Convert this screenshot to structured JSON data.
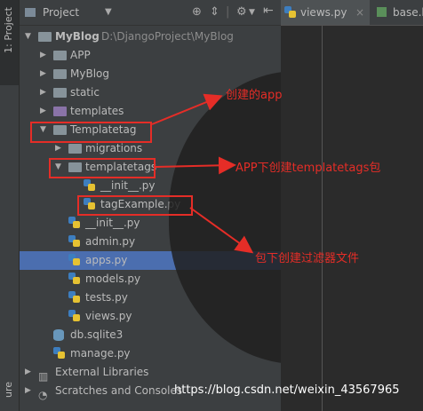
{
  "toolstrip": {
    "project_tab": "1: Project",
    "structure_tab": "ure"
  },
  "panel": {
    "title": "Project"
  },
  "tree": [
    {
      "label": "MyBlog",
      "path": "D:\\DjangoProject\\MyBlog",
      "icon": "folder-icon",
      "arrow": "▼"
    },
    {
      "label": "APP",
      "icon": "folder-icon",
      "arrow": "▶"
    },
    {
      "label": "MyBlog",
      "icon": "folder-icon",
      "arrow": "▶"
    },
    {
      "label": "static",
      "icon": "folder-icon",
      "arrow": "▶"
    },
    {
      "label": "templates",
      "icon": "templates-folder-icon",
      "arrow": "▶"
    },
    {
      "label": "Templatetag",
      "icon": "folder-icon",
      "arrow": "▼"
    },
    {
      "label": "migrations",
      "icon": "folder-icon",
      "arrow": "▶"
    },
    {
      "label": "templatetags",
      "icon": "folder-icon",
      "arrow": "▼"
    },
    {
      "label": "__init__.py",
      "icon": "python-file-icon",
      "arrow": ""
    },
    {
      "label": "tagExample.py",
      "icon": "python-file-icon",
      "arrow": ""
    },
    {
      "label": "__init__.py",
      "icon": "python-file-icon",
      "arrow": ""
    },
    {
      "label": "admin.py",
      "icon": "python-file-icon",
      "arrow": ""
    },
    {
      "label": "apps.py",
      "icon": "python-file-icon",
      "arrow": "",
      "selected": true
    },
    {
      "label": "models.py",
      "icon": "python-file-icon",
      "arrow": ""
    },
    {
      "label": "tests.py",
      "icon": "python-file-icon",
      "arrow": ""
    },
    {
      "label": "views.py",
      "icon": "python-file-icon",
      "arrow": ""
    },
    {
      "label": "db.sqlite3",
      "icon": "database-icon",
      "arrow": ""
    },
    {
      "label": "manage.py",
      "icon": "python-file-icon",
      "arrow": ""
    },
    {
      "label": "External Libraries",
      "icon": "libraries-icon",
      "arrow": "▶"
    },
    {
      "label": "Scratches and Consoles",
      "icon": "scratches-icon",
      "arrow": "▶"
    }
  ],
  "editor_tabs": [
    {
      "label": "views.py",
      "icon": "python-file-icon"
    },
    {
      "label": "base.h",
      "icon": "html-file-icon"
    }
  ],
  "annotations": {
    "app_created": "创建的app",
    "templatetags_pkg": "APP下创建templatetags包",
    "filter_file": "包下创建过滤器文件"
  },
  "watermark": "https://blog.csdn.net/weixin_43567965",
  "colors": {
    "annotation_red": "#e52d27",
    "selection_blue": "#4b6eaf"
  }
}
